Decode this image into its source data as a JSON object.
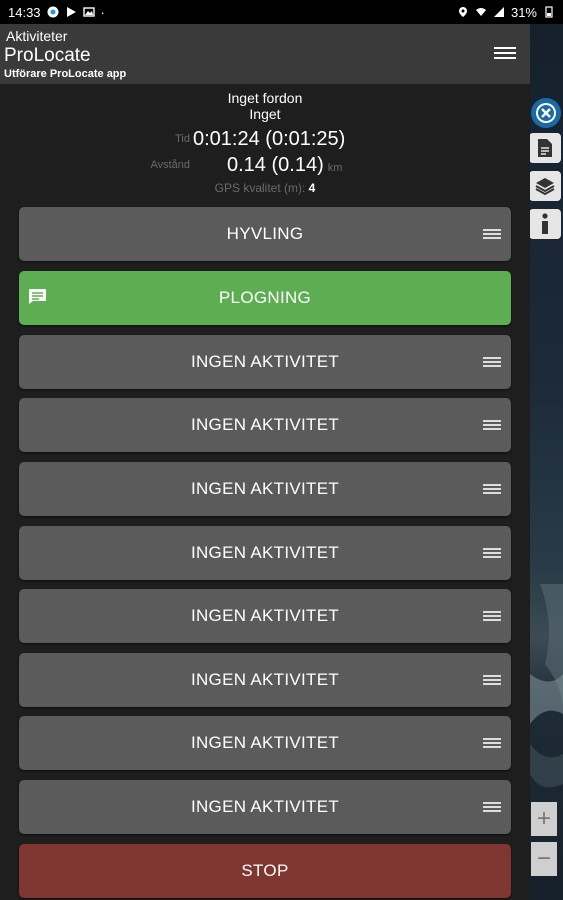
{
  "status_bar": {
    "time": "14:33",
    "battery": "31%"
  },
  "header": {
    "section": "Aktiviteter",
    "title": "ProLocate",
    "subtitle": "Utförare ProLocate app"
  },
  "info": {
    "vehicle": "Inget fordon",
    "vehicle_sub": "Inget",
    "time_label": "Tid",
    "time_value": "0:01:24 (0:01:25)",
    "distance_label": "Avstånd",
    "distance_value": "0.14 (0.14)",
    "distance_unit": "km",
    "gps_label": "GPS kvalitet (m):",
    "gps_value": "4"
  },
  "activities": [
    {
      "label": "HYVLING"
    },
    {
      "label": "PLOGNING"
    },
    {
      "label": "INGEN AKTIVITET"
    },
    {
      "label": "INGEN AKTIVITET"
    },
    {
      "label": "INGEN AKTIVITET"
    },
    {
      "label": "INGEN AKTIVITET"
    },
    {
      "label": "INGEN AKTIVITET"
    },
    {
      "label": "INGEN AKTIVITET"
    },
    {
      "label": "INGEN AKTIVITET"
    },
    {
      "label": "INGEN AKTIVITET"
    }
  ],
  "stop_label": "STOP",
  "map_controls": {
    "zoom_in": "+",
    "zoom_out": "−"
  },
  "colors": {
    "active": "#5dae52",
    "default": "#5b5b5b",
    "stop": "#7f3530",
    "appbar": "#3a3a3a",
    "map_accent": "#1a6aa6"
  }
}
